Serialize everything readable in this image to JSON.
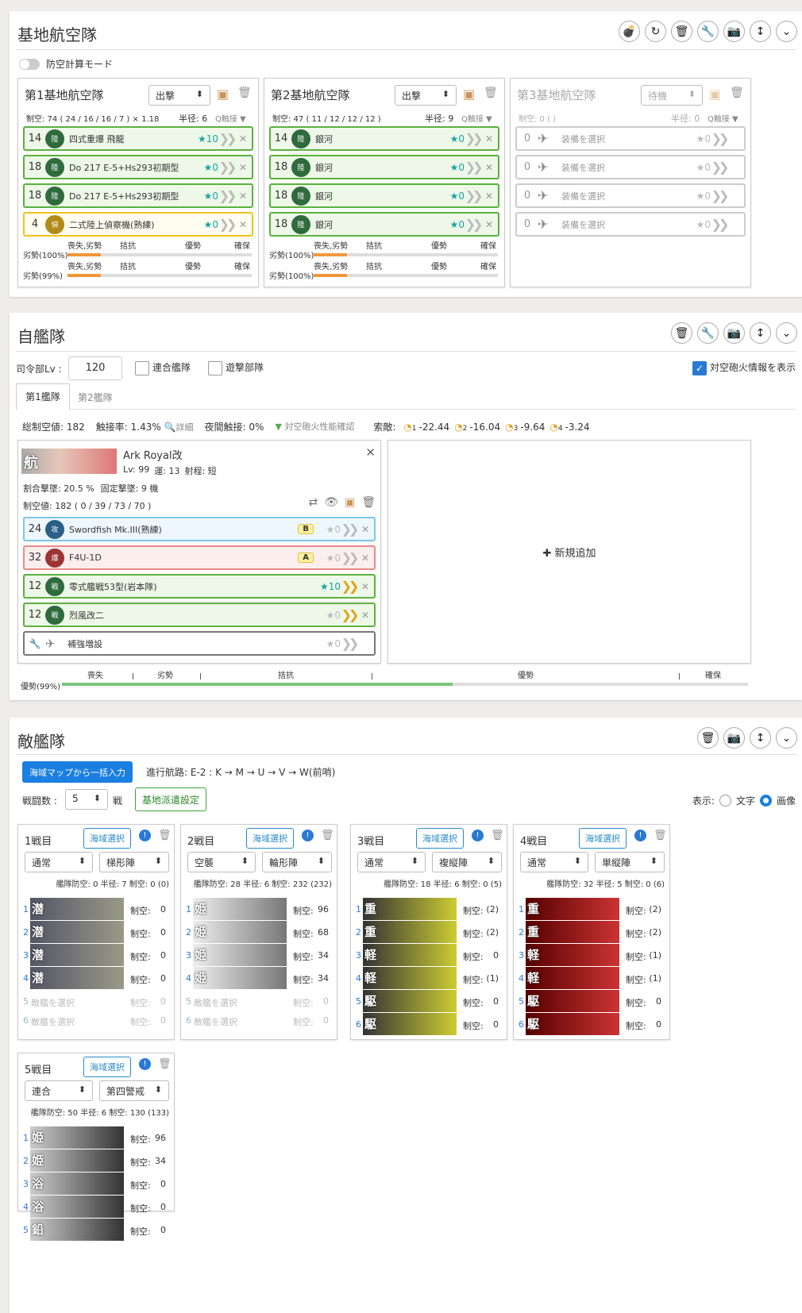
{
  "base": {
    "title": "基地航空隊",
    "aa_mode": "防空計算モード",
    "squads": [
      {
        "name": "第1基地航空隊",
        "mode": "出撃",
        "stats": "制空: 74 ( 24 / 16 / 16 / 7 ) × 1.18",
        "radius": "半径: 6",
        "contact": "Q触接 ▼",
        "items": [
          {
            "lv": "14",
            "icon": "陸",
            "name": "四式重爆 飛龍",
            "star": "★10",
            "c": "green"
          },
          {
            "lv": "18",
            "icon": "陸",
            "name": "Do 217 E-5+Hs293初期型",
            "star": "★0",
            "c": "green"
          },
          {
            "lv": "18",
            "icon": "陸",
            "name": "Do 217 E-5+Hs293初期型",
            "star": "★0",
            "c": "green"
          },
          {
            "lv": "4",
            "icon": "偵",
            "name": "二式陸上偵察機(熟練)",
            "star": "★0",
            "c": "yellow"
          }
        ],
        "res1": "劣勢(100%)",
        "res2": "劣勢(99%)"
      },
      {
        "name": "第2基地航空隊",
        "mode": "出撃",
        "stats": "制空: 47 ( 11 / 12 / 12 / 12 )",
        "radius": "半径: 9",
        "contact": "Q触接 ▼",
        "items": [
          {
            "lv": "14",
            "icon": "陸",
            "name": "銀河",
            "star": "★0",
            "c": "green"
          },
          {
            "lv": "18",
            "icon": "陸",
            "name": "銀河",
            "star": "★0",
            "c": "green"
          },
          {
            "lv": "18",
            "icon": "陸",
            "name": "銀河",
            "star": "★0",
            "c": "green"
          },
          {
            "lv": "18",
            "icon": "陸",
            "name": "銀河",
            "star": "★0",
            "c": "green"
          }
        ],
        "res1": "劣勢(100%)",
        "res2": "劣勢(100%)"
      },
      {
        "name": "第3基地航空隊",
        "mode": "待機",
        "stats": "制空: 0 ( )",
        "radius": "半径: 0",
        "contact": "Q触接 ▼",
        "items": [
          {
            "lv": "0",
            "name": "装備を選択",
            "star": "★0"
          },
          {
            "lv": "0",
            "name": "装備を選択",
            "star": "★0"
          },
          {
            "lv": "0",
            "name": "装備を選択",
            "star": "★0"
          },
          {
            "lv": "0",
            "name": "装備を選択",
            "star": "★0"
          }
        ]
      }
    ],
    "scale": {
      "a": "喪失",
      "b": "劣勢",
      "c": "拮抗",
      "d": "優勢",
      "e": "確保",
      "ab": "喪失,劣勢"
    }
  },
  "fleet": {
    "title": "自艦隊",
    "hq_label": "司令部Lv :",
    "hq_value": "120",
    "combined": "連合艦隊",
    "striking": "遊撃部隊",
    "aaci": "対空砲火情報を表示",
    "tab1": "第1艦隊",
    "tab2": "第2艦隊",
    "total": "総制空値: 182",
    "contact": "触接率: 1.43%",
    "detail": "詳細",
    "night": "夜間触接: 0%",
    "aa_check": "対空砲火性能確認",
    "los_label": "索敵:",
    "los": [
      "-22.44",
      "-16.04",
      "-9.64",
      "-3.24"
    ],
    "los_idx": [
      "1",
      "2",
      "3",
      "4"
    ],
    "ship": {
      "badge": "航",
      "name": "Ark Royal改",
      "lv": "Lv: 99",
      "luck": "運: 13",
      "range": "射程: 短",
      "shoot": "割合撃墜: 20.5 %",
      "fixed": "固定撃墜: 9 機",
      "air": "制空値: 182 ( 0 / 39 / 73 / 70 )"
    },
    "eq": [
      {
        "lv": "24",
        "icon": "攻",
        "name": "Swordfish Mk.III(熟練)",
        "badge": "B",
        "star": "★0",
        "c": "blue"
      },
      {
        "lv": "32",
        "icon": "爆",
        "name": "F4U-1D",
        "badge": "A",
        "star": "★0",
        "c": "red"
      },
      {
        "lv": "12",
        "icon": "戦",
        "name": "零式艦戦53型(岩本隊)",
        "star": "★10",
        "c": "green"
      },
      {
        "lv": "12",
        "icon": "戦",
        "name": "烈風改二",
        "star": "★0",
        "c": "green"
      },
      {
        "name": "補強増設",
        "star": "★0",
        "c": "dk"
      }
    ],
    "add": "✚ 新規追加",
    "result": "優勢(99%)"
  },
  "enemy": {
    "title": "敵艦隊",
    "map_btn": "海域マップから一括入力",
    "route": "進行航路:  E-2 : K → M → U → V → W(前哨)",
    "count_label": "戦闘数 :",
    "count": "5",
    "count_unit": "戦",
    "base_btn": "基地派遣設定",
    "display": "表示:",
    "text_opt": "文字",
    "img_opt": "画像",
    "sea_btn": "海域選択",
    "ak": "制空:",
    "empty": "敵艦を選択",
    "battles": [
      {
        "name": "1戦目",
        "f1": "通常",
        "f2": "梯形陣",
        "stat": "艦隊防空: 0  半径: 7  制空: 0 (0)",
        "ships": [
          {
            "t": "潜",
            "v": "0"
          },
          {
            "t": "潜",
            "v": "0"
          },
          {
            "t": "潜",
            "v": "0"
          },
          {
            "t": "潜",
            "v": "0"
          }
        ],
        "empty": 2
      },
      {
        "name": "2戦目",
        "f1": "空襲",
        "f2": "輪形陣",
        "stat": "艦隊防空: 28  半径: 6  制空: 232 (232)",
        "ships": [
          {
            "t": "姫",
            "v": "96"
          },
          {
            "t": "姫",
            "v": "68"
          },
          {
            "t": "姫",
            "v": "34"
          },
          {
            "t": "姫",
            "v": "34"
          }
        ],
        "empty": 2
      },
      {
        "name": "3戦目",
        "f1": "通常",
        "f2": "複縦陣",
        "stat": "艦隊防空: 18  半径: 6  制空: 0 (5)",
        "ships": [
          {
            "t": "重",
            "v": "(2)"
          },
          {
            "t": "重",
            "v": "(2)"
          },
          {
            "t": "軽",
            "v": "0"
          },
          {
            "t": "軽",
            "v": "(1)"
          },
          {
            "t": "駆",
            "v": "0"
          },
          {
            "t": "駆",
            "v": "0"
          }
        ],
        "empty": 0
      },
      {
        "name": "4戦目",
        "f1": "通常",
        "f2": "単縦陣",
        "stat": "艦隊防空: 32  半径: 5  制空: 0 (6)",
        "ships": [
          {
            "t": "重",
            "v": "(2)"
          },
          {
            "t": "重",
            "v": "(2)"
          },
          {
            "t": "軽",
            "v": "(1)"
          },
          {
            "t": "軽",
            "v": "(1)"
          },
          {
            "t": "駆",
            "v": "0"
          },
          {
            "t": "駆",
            "v": "0"
          }
        ],
        "empty": 0
      },
      {
        "name": "5戦目",
        "f1": "連合",
        "f2": "第四警戒",
        "stat": "艦隊防空: 50  半径: 6  制空: 130 (133)",
        "ships": [
          {
            "t": "姫",
            "v": "96"
          },
          {
            "t": "姫",
            "v": "34"
          },
          {
            "t": "浴",
            "v": "0"
          },
          {
            "t": "浴",
            "v": "0"
          },
          {
            "t": "鉛",
            "v": "0"
          }
        ],
        "empty": 0
      }
    ]
  }
}
